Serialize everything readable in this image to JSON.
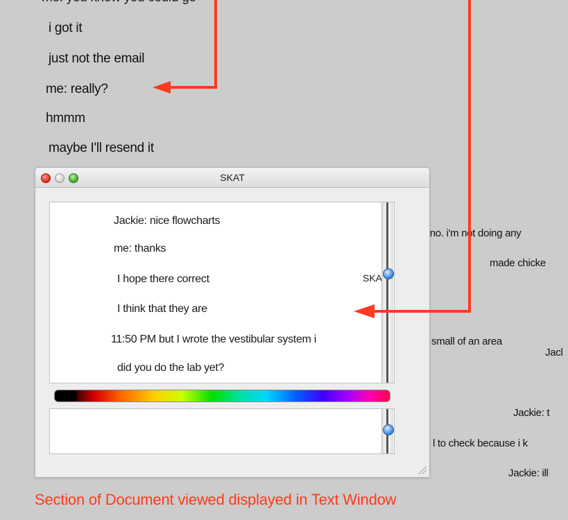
{
  "document": {
    "top_cut": "me: you know you could go",
    "lines": [
      "i got it",
      "just not the email",
      "me: really?",
      "hmmm",
      "maybe I'll resend it"
    ],
    "right_fragments": [
      ": no. i'm not doing any",
      "made chicke",
      "small of an area",
      "Jacl",
      "Jackie: t",
      "l to check because i k",
      "Jackie: ill"
    ]
  },
  "window": {
    "title": "SKAT",
    "chat_lines": [
      "Jackie: nice flowcharts",
      "me: thanks",
      "I hope there correct",
      "I think that they are",
      "11:50 PM but I wrote the vestibular system i",
      "did you do the lab yet?"
    ],
    "side_label": "SKAT",
    "input_value": ""
  },
  "caption": "Section of Document viewed displayed in Text Window",
  "colors": {
    "annotation": "#ff3a1e",
    "background": "#cccccc"
  },
  "icons": [
    "close-icon",
    "minimize-icon",
    "zoom-icon",
    "resize-grip-icon"
  ]
}
